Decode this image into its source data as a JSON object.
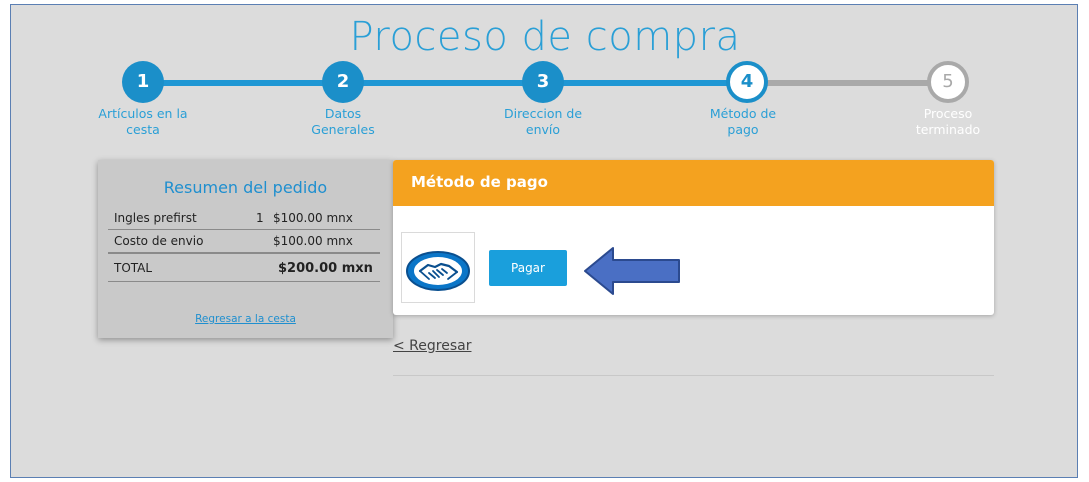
{
  "page": {
    "title": "Proceso de compra"
  },
  "colors": {
    "primary": "#1b8fc9",
    "accent": "#f4a21f",
    "pending": "#a9a9a9",
    "button": "#1a9fdc"
  },
  "steps": [
    {
      "number": "1",
      "line1": "Artículos en la",
      "line2": "cesta",
      "state": "done"
    },
    {
      "number": "2",
      "line1": "Datos",
      "line2": "Generales",
      "state": "done"
    },
    {
      "number": "3",
      "line1": "Direccion de",
      "line2": "envío",
      "state": "done"
    },
    {
      "number": "4",
      "line1": "Método de",
      "line2": "pago",
      "state": "current"
    },
    {
      "number": "5",
      "line1": "Proceso",
      "line2": "terminado",
      "state": "pending"
    }
  ],
  "summary": {
    "title": "Resumen del pedido",
    "rows": [
      {
        "name": "Ingles prefirst",
        "qty": "1",
        "price": "$100.00 mnx"
      },
      {
        "name": "Costo de envio",
        "qty": "",
        "price": "$100.00 mnx"
      }
    ],
    "total": {
      "label": "TOTAL",
      "value": "$200.00 mxn"
    },
    "back_to_cart": "Regresar a la cesta"
  },
  "payment": {
    "header": "Método de pago",
    "logo_icon": "mercadopago-handshake-icon",
    "pay_button": "Pagar",
    "arrow_icon": "arrow-left-icon"
  },
  "back_link": "< Regresar"
}
